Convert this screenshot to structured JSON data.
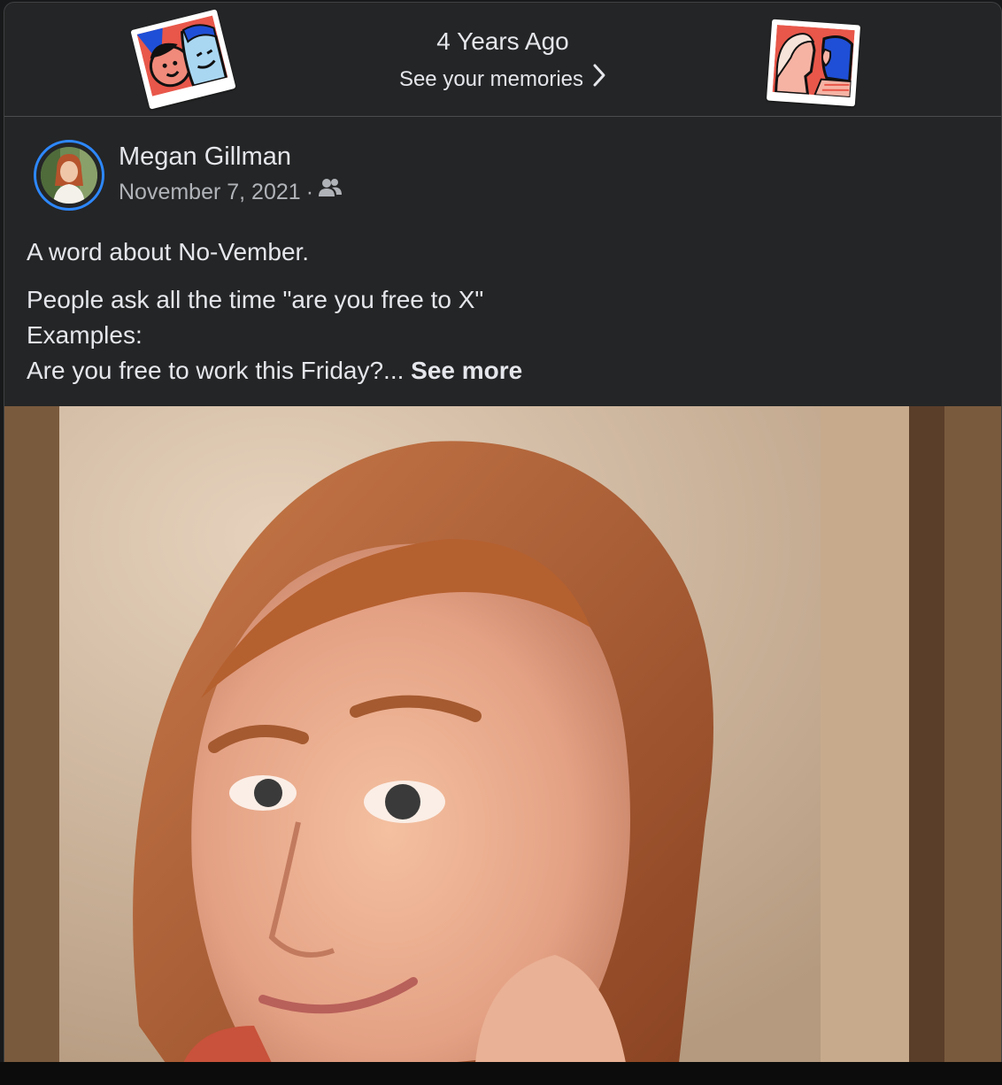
{
  "memories": {
    "title": "4 Years Ago",
    "link_label": "See your memories"
  },
  "post": {
    "author": "Megan Gillman",
    "date": "November 7, 2021",
    "separator": "·",
    "audience_icon": "friends-icon",
    "line1": "A word about No-Vember.",
    "line2": "People ask all the time \"are you free to X\"",
    "line3": "Examples:",
    "line4": "Are you free to work this Friday?...",
    "see_more": "See more"
  },
  "colors": {
    "card_bg": "#242526",
    "text": "#e4e6eb",
    "secondary_text": "#b0b3b8",
    "story_ring": "#2d88ff"
  }
}
